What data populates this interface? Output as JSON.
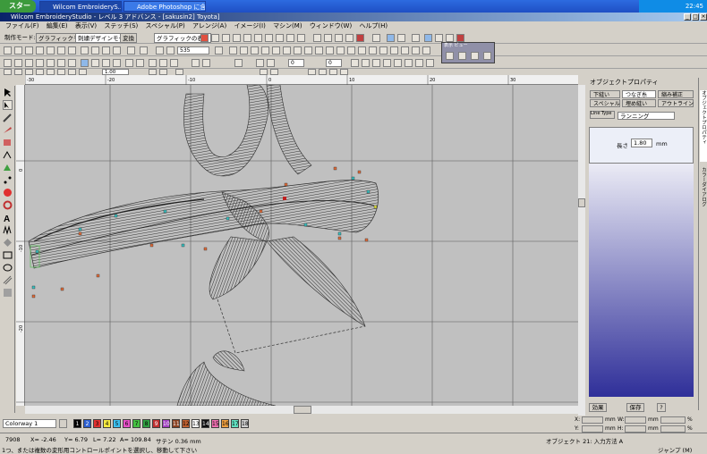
{
  "taskbar": {
    "start": "スタート",
    "items": [
      "Wilcom EmbroideryS...",
      "Adobe Photoshop に含..."
    ],
    "clock": "22:45"
  },
  "window": {
    "title": "Wilcom EmbroideryStudio - レベル 3 アドバンス - [sakusin2]        Toyota]"
  },
  "menu": [
    "ファイル(F)",
    "編集(E)",
    "表示(V)",
    "ステッチ(S)",
    "スペシャル(P)",
    "アレンジ(A)",
    "イメージ(I)",
    "マシン(M)",
    "ウィンドウ(W)",
    "ヘルプ(H)"
  ],
  "mode_toolbar": {
    "label": "制作モード:",
    "graphic_mode": "グラフィックモード",
    "stitch_design_mode": "刺繍デザインモード",
    "convert": "変換",
    "graphic_display": "グラフィックの表示"
  },
  "zoom": {
    "value": "535"
  },
  "stitch_length": {
    "value": "1.00"
  },
  "spin1": "0",
  "spin2": "0",
  "floating": {
    "title": "表示 ビュー"
  },
  "panel": {
    "title": "オブジェクトプロパティ",
    "tabs": [
      "下縫い",
      "つなぎ糸",
      "縮み補正",
      "スペシャル",
      "埋め縫い",
      "アウトライン"
    ],
    "type_label": "Line Type",
    "type_value": "ランニング",
    "length_label": "長さ",
    "length_value": "1.80",
    "length_unit": "mm",
    "buttons": {
      "effects": "効果",
      "save": "保存",
      "help": "?"
    }
  },
  "sidebar_tabs": [
    "オブジェクトプロパティ",
    "カラーダイアログ"
  ],
  "colorway": {
    "label": "Colorway 1",
    "swatches": [
      {
        "n": "1",
        "c": "#000000"
      },
      {
        "n": "2",
        "c": "#2c5fd0"
      },
      {
        "n": "3",
        "c": "#e03030"
      },
      {
        "n": "4",
        "c": "#f3e840"
      },
      {
        "n": "5",
        "c": "#3cc0f0"
      },
      {
        "n": "6",
        "c": "#e850c8"
      },
      {
        "n": "7",
        "c": "#44c040"
      },
      {
        "n": "8",
        "c": "#30a040"
      },
      {
        "n": "9",
        "c": "#c03030"
      },
      {
        "n": "10",
        "c": "#a040c0"
      },
      {
        "n": "11",
        "c": "#8a4020"
      },
      {
        "n": "12",
        "c": "#c06030"
      },
      {
        "n": "13",
        "c": "#ffffff"
      },
      {
        "n": "14",
        "c": "#101010"
      },
      {
        "n": "15",
        "c": "#f070b0"
      },
      {
        "n": "16",
        "c": "#f0a040"
      },
      {
        "n": "17",
        "c": "#60e0c0"
      },
      {
        "n": "18",
        "c": "#d0d0d0"
      }
    ]
  },
  "coords": {
    "x": "X:",
    "y": "Y:",
    "mm1": "mm",
    "mm2": "mm",
    "w": "W:",
    "h": "H:",
    "mm3": "mm",
    "mm4": "mm",
    "pct1": "%",
    "pct2": "%"
  },
  "status": {
    "count": "7908",
    "x": "X= -2.46",
    "y": "Y= 6.79",
    "l": "L= 7.22",
    "a": "A= 109.84",
    "sample": "サテン 0.36 mm",
    "object": "オブジェクト 21: 入力方法 A",
    "hint": "1つ、または複数の変形用コントロールポイントを選択し、移動して下さい",
    "jump": "ジャンプ (M)"
  },
  "ruler": {
    "top": [
      "-30",
      "-20",
      "-10",
      "0",
      "10",
      "20",
      "30",
      "40"
    ],
    "left": [
      "0",
      "-10",
      "-20",
      "-30"
    ]
  }
}
